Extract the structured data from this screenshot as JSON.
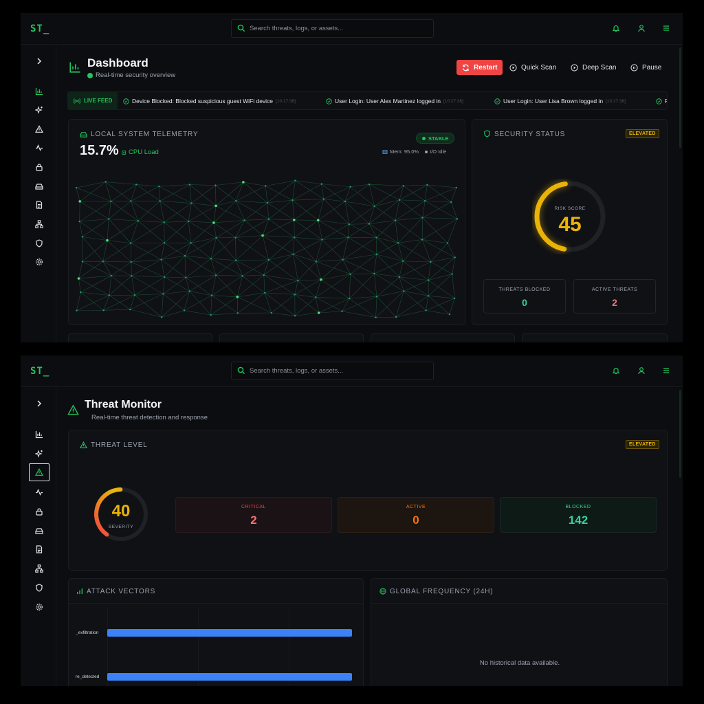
{
  "app": {
    "logo": "ST_",
    "search_placeholder": "Search threats, logs, or assets..."
  },
  "dashboard": {
    "title": "Dashboard",
    "subtitle": "Real-time security overview",
    "actions": {
      "restart": "Restart",
      "quick_scan": "Quick Scan",
      "deep_scan": "Deep Scan",
      "pause": "Pause"
    },
    "feed": {
      "label": "LIVE FEED",
      "items": [
        {
          "text": "Device Blocked: Blocked suspicious guest WiFi device",
          "time": "[10:17:36]"
        },
        {
          "text": "User Login: User Alex Martinez logged in",
          "time": "[10:27:36]"
        },
        {
          "text": "User Login: User Lisa Brown logged in",
          "time": "[10:27:36]"
        },
        {
          "text": "F",
          "time": ""
        }
      ]
    },
    "telemetry": {
      "title": "LOCAL SYSTEM TELEMETRY",
      "value": "15.7%",
      "value_label": "CPU Load",
      "badge": "STABLE",
      "mem": "Mem: 95.0%",
      "io": "I/O Idle"
    },
    "security": {
      "title": "SECURITY STATUS",
      "badge": "ELEVATED",
      "risk_label": "RISK SCORE",
      "risk_score": 45,
      "risk_fraction": 0.45,
      "threats_blocked_label": "THREATS BLOCKED",
      "threats_blocked": "0",
      "active_threats_label": "ACTIVE THREATS",
      "active_threats": "2"
    }
  },
  "threat_monitor": {
    "title": "Threat Monitor",
    "subtitle": "Real-time threat detection and response",
    "level": {
      "title": "THREAT LEVEL",
      "badge": "ELEVATED",
      "severity": 40,
      "severity_fraction": 0.4,
      "severity_label": "SEVERITY",
      "critical_label": "CRITICAL",
      "critical": "2",
      "active_label": "ACTIVE",
      "active": "0",
      "blocked_label": "BLOCKED",
      "blocked": "142"
    },
    "vectors": {
      "title": "ATTACK VECTORS",
      "bars": [
        {
          "label": "_exfiltration",
          "fraction": 1.0
        },
        {
          "label": "re_detected",
          "fraction": 1.0
        }
      ]
    },
    "frequency": {
      "title": "GLOBAL FREQUENCY (24H)",
      "empty": "No historical data available."
    }
  },
  "colors": {
    "accent": "#22c55e",
    "danger": "#ef4444",
    "warning": "#eab308",
    "orange": "#f97316",
    "teal": "#34d399",
    "bar": "#3b82f6"
  }
}
